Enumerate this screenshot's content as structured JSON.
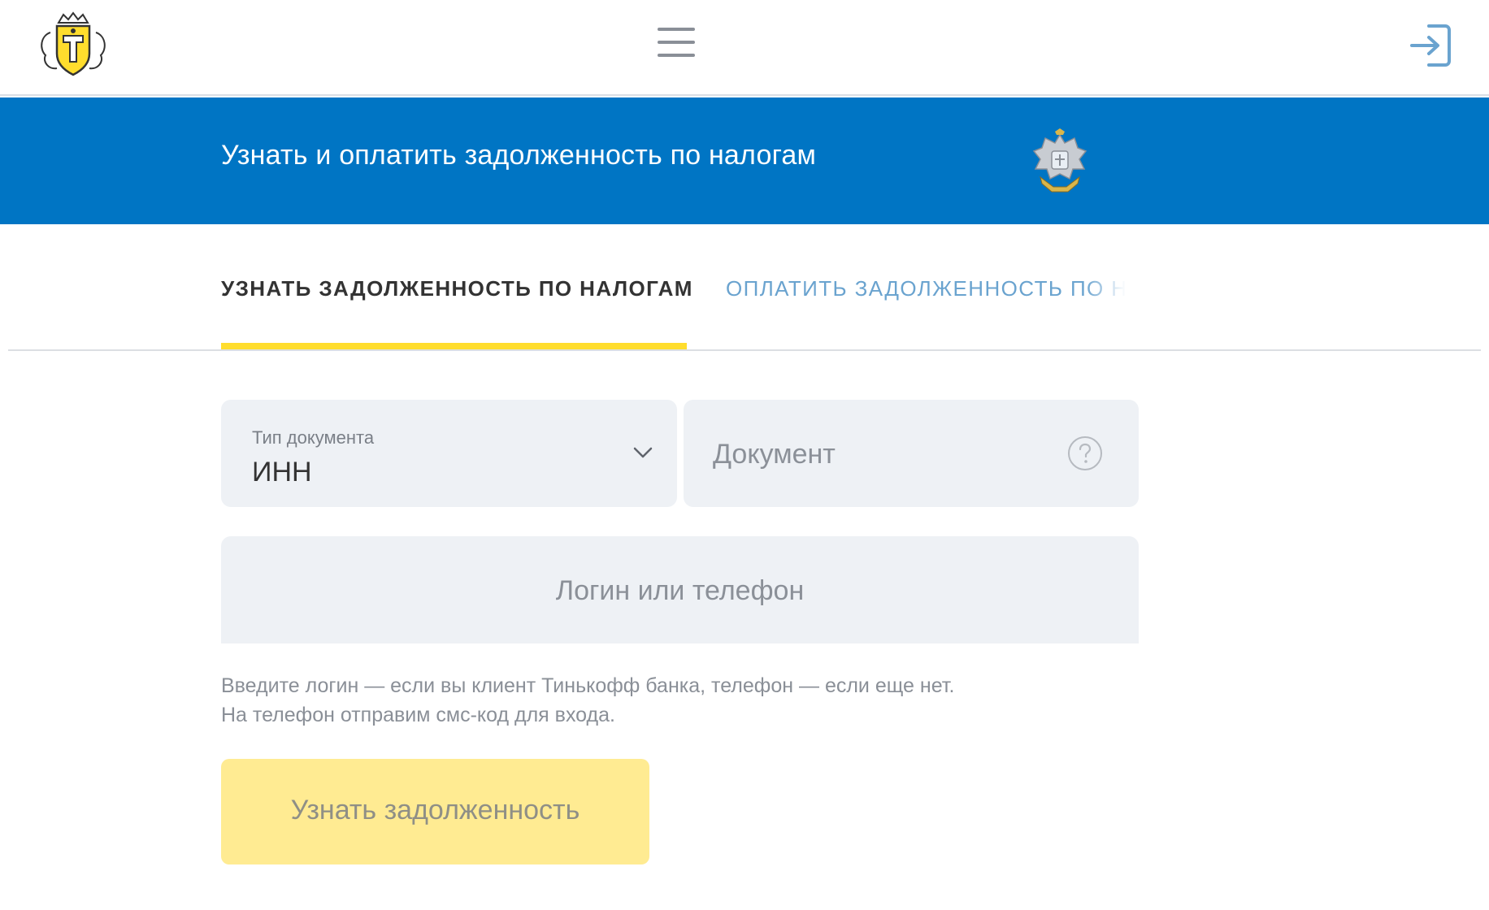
{
  "header": {
    "logo_icon": "bank-coat-of-arms-logo",
    "menu_icon": "hamburger-menu-icon",
    "login_icon": "login-arrow-icon"
  },
  "banner": {
    "title": "Узнать и оплатить задолженность по налогам",
    "emblem_icon": "double-headed-eagle-emblem",
    "background": "#0075c4"
  },
  "tabs": [
    {
      "label": "УЗНАТЬ ЗАДОЛЖЕННОСТЬ ПО НАЛОГАМ",
      "active": true
    },
    {
      "label": "ОПЛАТИТЬ ЗАДОЛЖЕННОСТЬ ПО НАЛОГАМ",
      "active": false
    }
  ],
  "form": {
    "doc_type": {
      "label": "Тип документа",
      "value": "ИНН",
      "icon": "chevron-down-icon"
    },
    "document": {
      "placeholder": "Документ",
      "icon": "question-circle-icon"
    },
    "login": {
      "placeholder": "Логин или телефон"
    },
    "hint_line1": "Введите логин — если вы клиент Тинькофф банка, телефон — если еще нет.",
    "hint_line2": "На телефон отправим смс-код для входа.",
    "submit_label": "Узнать задолженность"
  },
  "colors": {
    "accent_yellow": "#ffdd2d",
    "button_disabled": "#ffeb92",
    "field_bg": "#eef1f5"
  }
}
